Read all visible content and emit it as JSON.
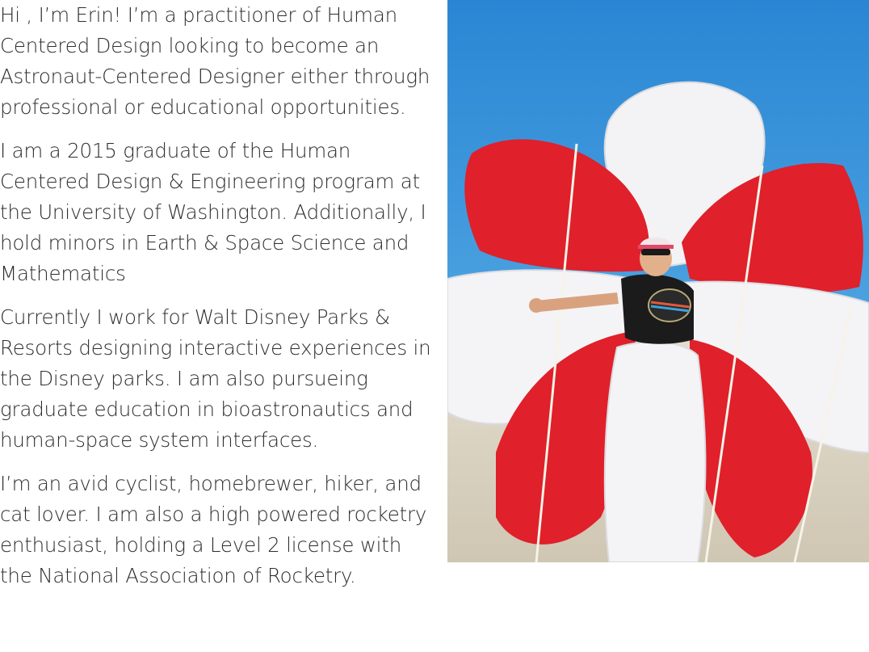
{
  "bio": {
    "paragraphs": [
      "Hi , I’m Erin! I’m a practitioner of Human Centered Design looking to become an Astronaut-Centered Designer either through professional or educational opportunities.",
      "I am a 2015 graduate of the Human Centered Design & Engineering program at the University of Washington. Additionally, I hold minors in Earth & Space Science and Mathematics",
      "Currently I work for Walt Disney Parks & Resorts designing interactive experiences in the Disney parks. I am also pursueing graduate education in bioastronautics and human-space system interfaces.",
      "I’m an avid cyclist, homebrewer, hiker, and cat lover. I am also a high powered rocketry enthusiast, holding a Level 2 license with the National Association of Rocketry."
    ]
  },
  "photo": {
    "colors": {
      "sky": "#2f8fd8",
      "sky_light": "#8fc8ef",
      "ground": "#d9d2c2",
      "canopy_red": "#e0202a",
      "canopy_white": "#f4f4f6",
      "shirt": "#1b1b1b"
    }
  }
}
